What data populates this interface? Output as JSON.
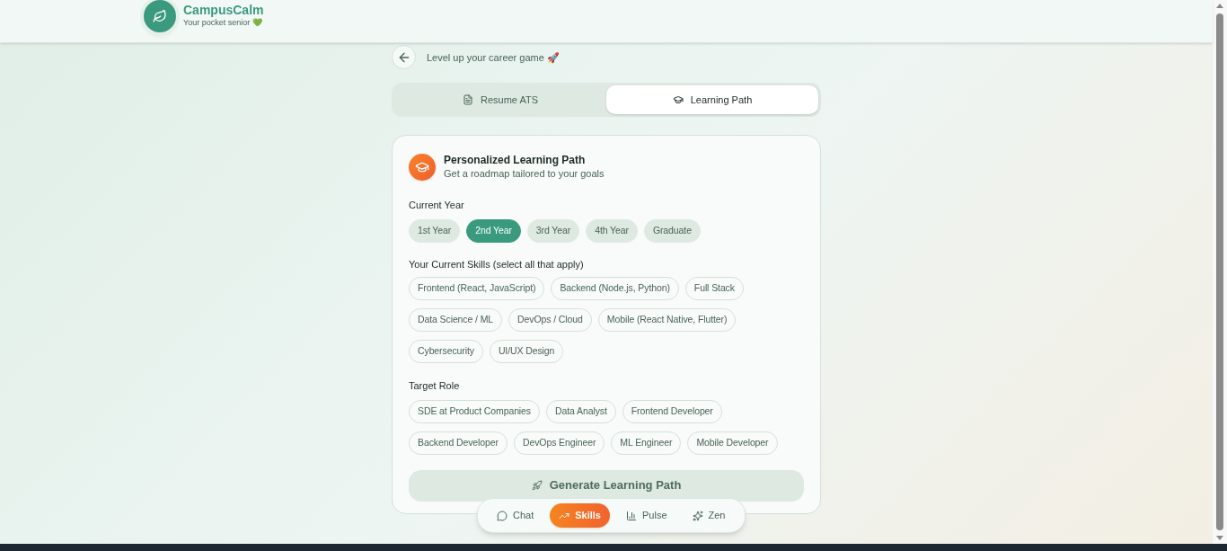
{
  "header": {
    "brand": "CampusCalm",
    "tagline": "Your pocket senior 💚"
  },
  "page": {
    "subtitle": "Level up your career game 🚀"
  },
  "tabs": [
    {
      "label": "Resume ATS",
      "selected": false
    },
    {
      "label": "Learning Path",
      "selected": true
    }
  ],
  "card": {
    "title": "Personalized Learning Path",
    "subtitle": "Get a roadmap tailored to your goals",
    "year": {
      "label": "Current Year",
      "options": [
        {
          "label": "1st Year",
          "selected": false
        },
        {
          "label": "2nd Year",
          "selected": true
        },
        {
          "label": "3rd Year",
          "selected": false
        },
        {
          "label": "4th Year",
          "selected": false
        },
        {
          "label": "Graduate",
          "selected": false
        }
      ]
    },
    "skills": {
      "label": "Your Current Skills (select all that apply)",
      "options": [
        {
          "label": "Frontend (React, JavaScript)",
          "selected": false
        },
        {
          "label": "Backend (Node.js, Python)",
          "selected": false
        },
        {
          "label": "Full Stack",
          "selected": false
        },
        {
          "label": "Data Science / ML",
          "selected": false
        },
        {
          "label": "DevOps / Cloud",
          "selected": false
        },
        {
          "label": "Mobile (React Native, Flutter)",
          "selected": false
        },
        {
          "label": "Cybersecurity",
          "selected": false
        },
        {
          "label": "UI/UX Design",
          "selected": false
        }
      ]
    },
    "roles": {
      "label": "Target Role",
      "options": [
        {
          "label": "SDE at Product Companies",
          "selected": false
        },
        {
          "label": "Data Analyst",
          "selected": false
        },
        {
          "label": "Frontend Developer",
          "selected": false
        },
        {
          "label": "Backend Developer",
          "selected": false
        },
        {
          "label": "DevOps Engineer",
          "selected": false
        },
        {
          "label": "ML Engineer",
          "selected": false
        },
        {
          "label": "Mobile Developer",
          "selected": false
        }
      ]
    },
    "generate_button": {
      "label": "Generate Learning Path",
      "disabled": true
    }
  },
  "bottom_nav": [
    {
      "label": "Chat",
      "selected": false
    },
    {
      "label": "Skills",
      "selected": true
    },
    {
      "label": "Pulse",
      "selected": false
    },
    {
      "label": "Zen",
      "selected": false
    }
  ]
}
